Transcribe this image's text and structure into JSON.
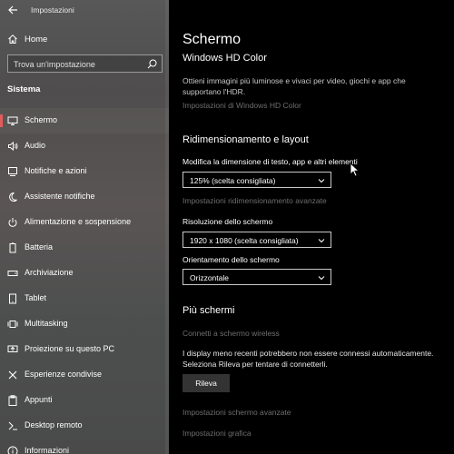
{
  "window": {
    "title": "Impostazioni"
  },
  "sidebar": {
    "home_label": "Home",
    "search_placeholder": "Trova un'impostazione",
    "section_header": "Sistema",
    "items": [
      {
        "label": "Schermo",
        "icon": "monitor-icon",
        "active": true
      },
      {
        "label": "Audio",
        "icon": "speaker-icon"
      },
      {
        "label": "Notifiche e azioni",
        "icon": "notifications-icon"
      },
      {
        "label": "Assistente notifiche",
        "icon": "moon-icon"
      },
      {
        "label": "Alimentazione e sospensione",
        "icon": "power-icon"
      },
      {
        "label": "Batteria",
        "icon": "battery-icon"
      },
      {
        "label": "Archiviazione",
        "icon": "storage-icon"
      },
      {
        "label": "Tablet",
        "icon": "tablet-icon"
      },
      {
        "label": "Multitasking",
        "icon": "multitasking-icon"
      },
      {
        "label": "Proiezione su questo PC",
        "icon": "projection-icon"
      },
      {
        "label": "Esperienze condivise",
        "icon": "shared-experiences-icon"
      },
      {
        "label": "Appunti",
        "icon": "clipboard-icon"
      },
      {
        "label": "Desktop remoto",
        "icon": "remote-desktop-icon"
      },
      {
        "label": "Informazioni",
        "icon": "info-icon"
      }
    ]
  },
  "main": {
    "title": "Schermo",
    "hdr": {
      "title": "Windows HD Color",
      "description": "Ottieni immagini più luminose e vivaci per video, giochi e app che supportano l'HDR.",
      "link": "Impostazioni di Windows HD Color"
    },
    "scale_layout": {
      "title": "Ridimensionamento e layout",
      "size_label": "Modifica la dimensione di testo, app e altri elementi",
      "size_value": "125% (scelta consigliata)",
      "advanced_link": "Impostazioni ridimensionamento avanzate",
      "resolution_label": "Risoluzione dello schermo",
      "resolution_value": "1920 x 1080 (scelta consigliata)",
      "orientation_label": "Orientamento dello schermo",
      "orientation_value": "Orizzontale"
    },
    "multi": {
      "title": "Più schermi",
      "wireless_link": "Connetti a schermo wireless",
      "description": "I display meno recenti potrebbero non essere connessi automaticamente. Seleziona Rileva per tentare di connetterli.",
      "detect_button": "Rileva",
      "advanced_link": "Impostazioni schermo avanzate",
      "graphics_link": "Impostazioni grafica"
    }
  },
  "colors": {
    "accent": "#e25c5c",
    "link": "#6e6e6e",
    "background": "#000000"
  }
}
